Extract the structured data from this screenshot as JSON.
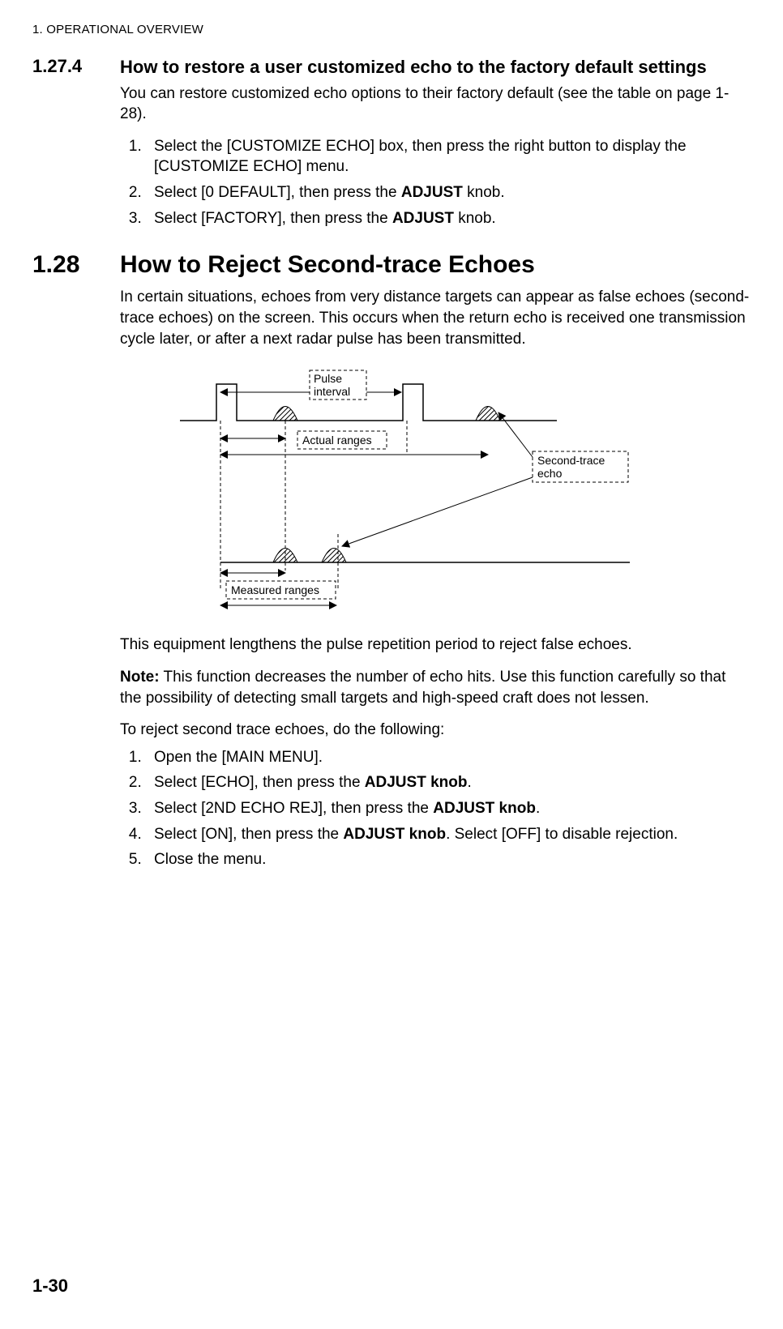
{
  "header": {
    "running": "1.  OPERATIONAL OVERVIEW"
  },
  "section1": {
    "num": "1.27.4",
    "title": "How to restore a user customized echo to the factory default settings",
    "intro": "You can restore customized echo options to their factory default (see the table on page 1-28).",
    "steps": [
      {
        "pre": "Select the [CUSTOMIZE ECHO] box, then press the right button to display the [CUSTOMIZE ECHO] menu."
      },
      {
        "pre": "Select [0 DEFAULT], then press the ",
        "bold": "ADJUST",
        "post": " knob."
      },
      {
        "pre": "Select [FACTORY], then press the ",
        "bold": "ADJUST",
        "post": " knob."
      }
    ]
  },
  "section2": {
    "num": "1.28",
    "title": "How to Reject Second-trace Echoes",
    "intro": "In certain situations, echoes from very distance targets can appear as false echoes (second-trace echoes) on the screen. This occurs when the return echo is received one transmission cycle later, or after a next radar pulse has been transmitted.",
    "afterFigure": "This equipment lengthens the pulse repetition period to reject false echoes.",
    "noteLabel": "Note:",
    "noteBody": " This function decreases the number of echo hits. Use this function carefully so that the possibility of detecting small targets and high-speed craft does not lessen.",
    "lead": "To reject second trace echoes, do the following:",
    "steps": [
      {
        "pre": "Open the [MAIN MENU]."
      },
      {
        "pre": "Select [ECHO], then press the ",
        "bold": "ADJUST knob",
        "post": "."
      },
      {
        "pre": "Select [2ND ECHO REJ], then press the ",
        "bold": "ADJUST knob",
        "post": "."
      },
      {
        "pre": "Select [ON], then press the ",
        "bold": "ADJUST knob",
        "post": ". Select [OFF] to disable rejection."
      },
      {
        "pre": "Close the menu."
      }
    ]
  },
  "figure": {
    "labels": {
      "pulseInterval1": "Pulse",
      "pulseInterval2": "interval",
      "actualRanges": "Actual ranges",
      "secondTrace1": "Second-trace",
      "secondTrace2": "echo",
      "measuredRanges": "Measured ranges"
    }
  },
  "pageNumber": "1-30"
}
